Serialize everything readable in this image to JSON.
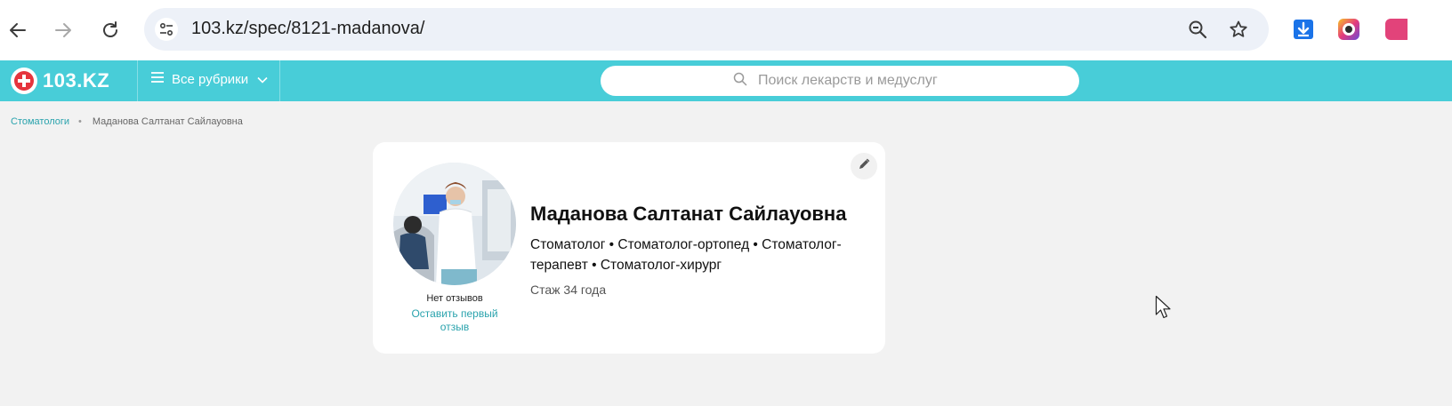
{
  "browser": {
    "url": "103.kz/spec/8121-madanova/",
    "icons": [
      "back-arrow-icon",
      "forward-arrow-icon",
      "reload-icon",
      "tune-icon",
      "zoom-out-icon",
      "star-icon",
      "download-icon",
      "extension-icon"
    ]
  },
  "header": {
    "logo_text": "103.KZ",
    "rubrics_label": "Все рубрики",
    "search_placeholder": "Поиск лекарств и медуслуг",
    "accent_color": "#48cdd8"
  },
  "breadcrumb": {
    "link": "Стоматологи",
    "separator": "•",
    "current": "Маданова Салтанат Сайлауовна"
  },
  "doctor": {
    "name": "Маданова Салтанат Сайлауовна",
    "specialties": "Стоматолог • Стоматолог-ортопед • Стоматолог-терапевт • Стоматолог-хирург",
    "experience": "Стаж 34 года",
    "reviews_none": "Нет отзывов",
    "reviews_link": "Оставить первый отзыв"
  }
}
